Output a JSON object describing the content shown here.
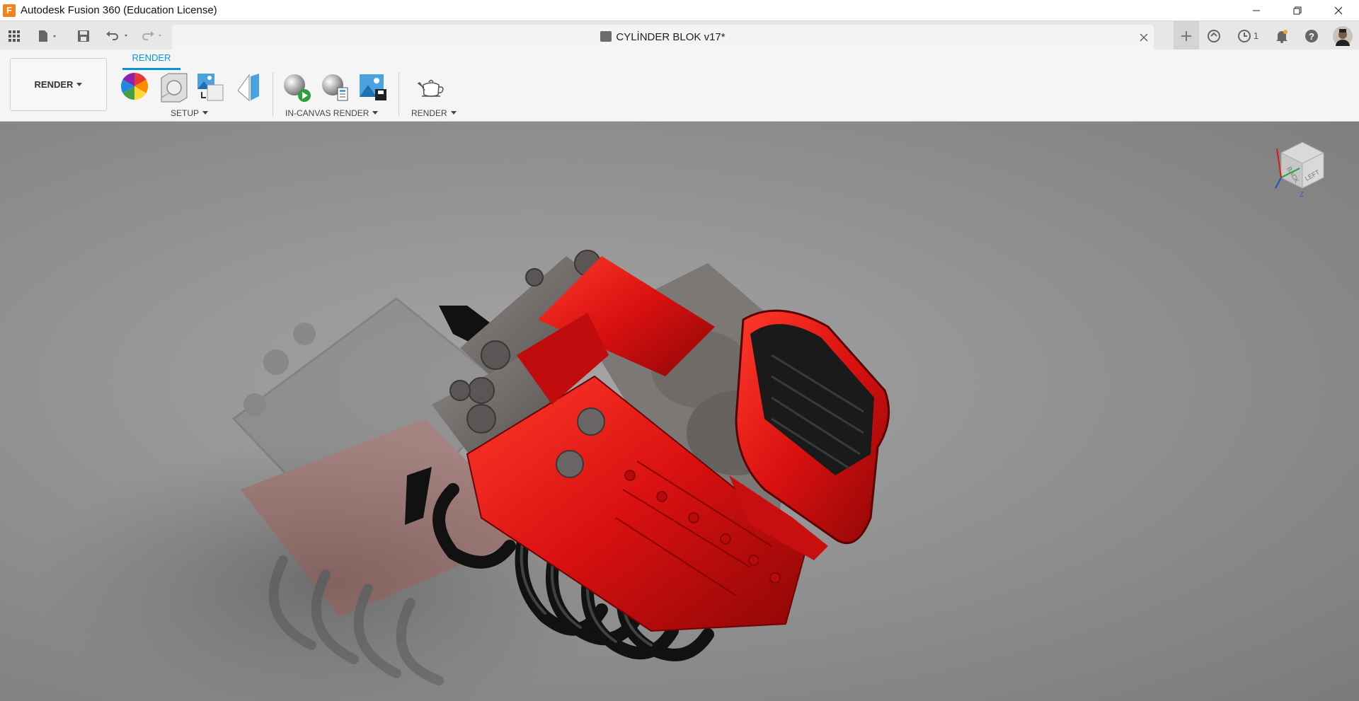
{
  "window": {
    "title": "Autodesk Fusion 360 (Education License)",
    "logo_letter": "F"
  },
  "tabbar": {
    "document_title": "CYLİNDER BLOK v17*",
    "job_count": "1"
  },
  "toolbar": {
    "workspace_label": "RENDER",
    "active_tab": "RENDER",
    "groups": {
      "setup": "SETUP",
      "in_canvas": "IN-CANVAS RENDER",
      "render": "RENDER"
    }
  },
  "viewcube": {
    "face_back": "BACK",
    "face_left": "LEFT",
    "axis_z": "Z"
  },
  "colors": {
    "accent": "#0696d7",
    "engine_red": "#e01010",
    "viewport_bg": "#8e8e8e"
  },
  "icons": [
    "grid-icon",
    "file-icon",
    "save-icon",
    "undo-icon",
    "redo-icon",
    "close-icon",
    "plus-icon",
    "sync-icon",
    "job-clock-icon",
    "bell-icon",
    "help-icon",
    "avatar",
    "appearance-icon",
    "scene-settings-icon",
    "texture-map-icon",
    "decal-icon",
    "in-canvas-start-icon",
    "in-canvas-settings-icon",
    "capture-image-icon",
    "render-teapot-icon"
  ]
}
